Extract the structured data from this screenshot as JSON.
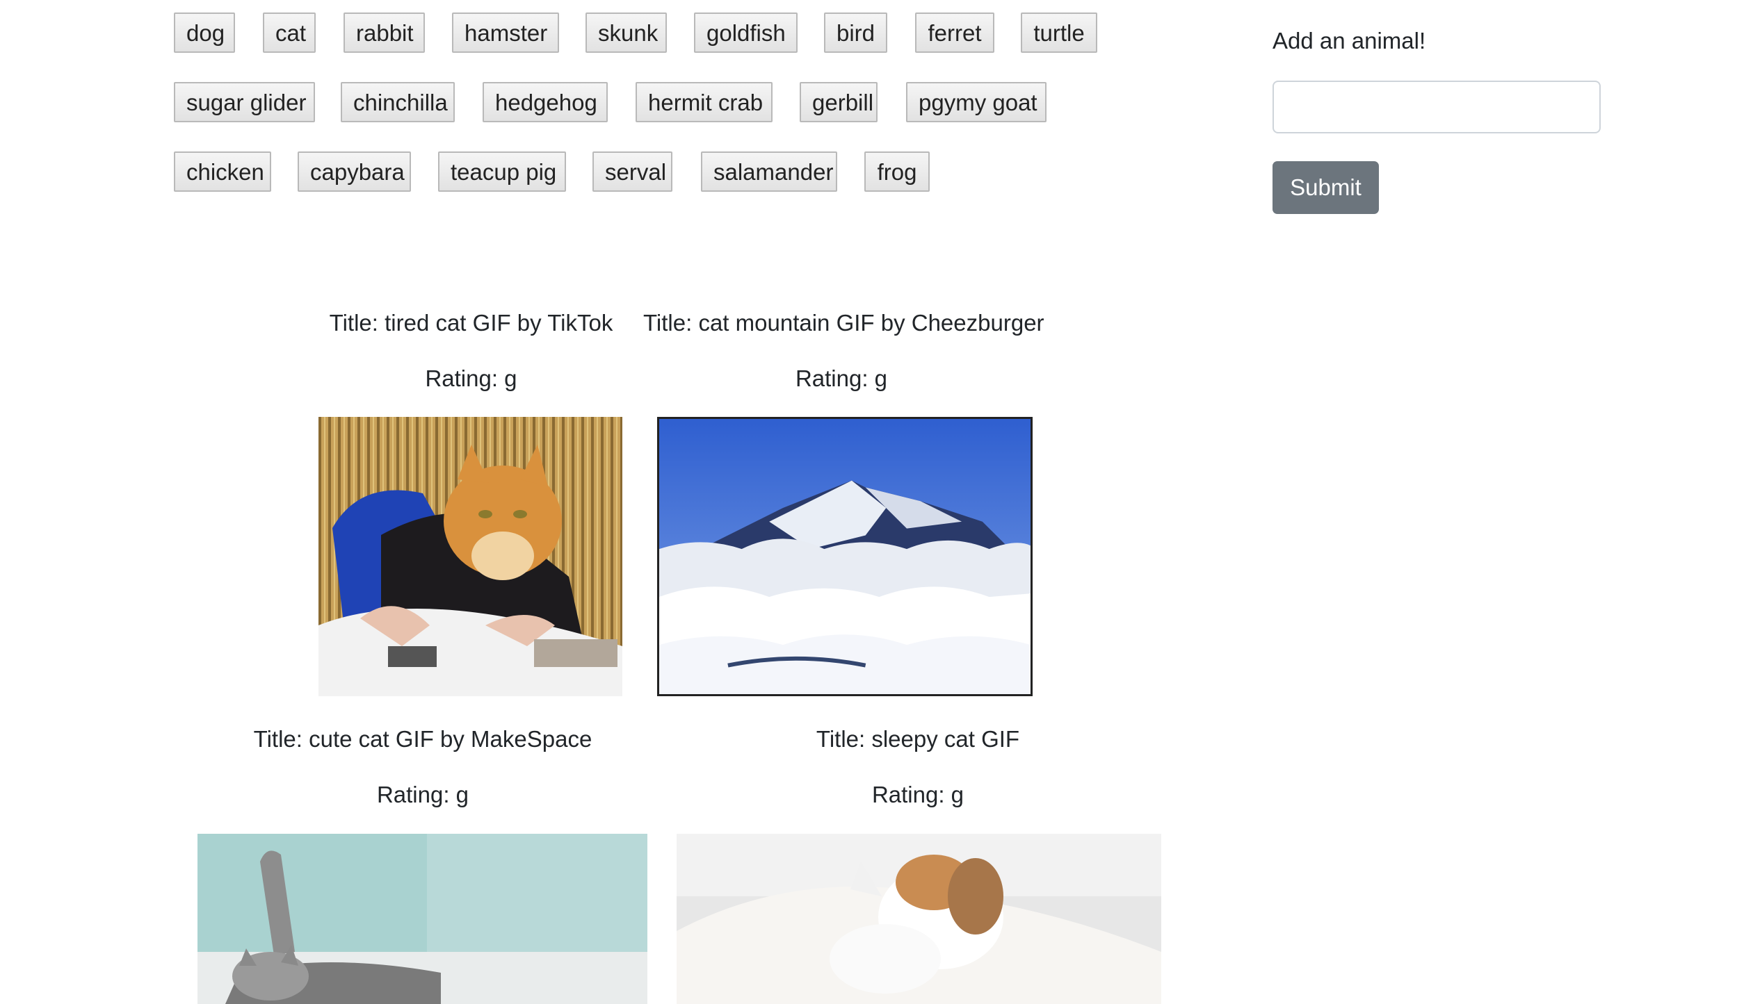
{
  "animal_buttons": {
    "rows": [
      [
        "dog",
        "cat",
        "rabbit",
        "hamster",
        "skunk",
        "goldfish",
        "bird",
        "ferret",
        "turtle"
      ],
      [
        "sugar glider",
        "chinchilla",
        "hedgehog",
        "hermit crab",
        "gerbill",
        "pgymy goat"
      ],
      [
        "chicken",
        "capybara",
        "teacup pig",
        "serval",
        "salamander",
        "frog"
      ]
    ]
  },
  "form": {
    "label": "Add an animal!",
    "input_value": "",
    "input_placeholder": "",
    "submit_label": "Submit"
  },
  "gifs": [
    {
      "title": "Title: tired cat GIF by TikTok",
      "rating": "Rating: g",
      "image": "cat-reading-magazine"
    },
    {
      "title": "Title: cat mountain GIF by Cheezburger",
      "rating": "Rating: g",
      "image": "snowy-mountain-above-clouds"
    },
    {
      "title": "Title: cute cat GIF by MakeSpace",
      "rating": "Rating: g",
      "image": "tabby-cat-stretching"
    },
    {
      "title": "Title: sleepy cat GIF",
      "rating": "Rating: g",
      "image": "white-cat-sleeping"
    }
  ],
  "colors": {
    "submit_bg": "#6c757d",
    "text": "#212529"
  }
}
